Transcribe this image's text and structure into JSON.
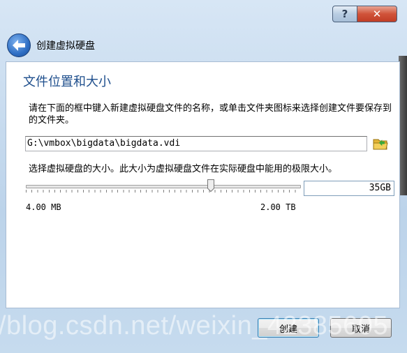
{
  "window": {
    "help_label": "?",
    "close_label": "✕"
  },
  "header": {
    "title": "创建虚拟硬盘",
    "back_icon": "back-arrow-icon"
  },
  "content": {
    "section_title": "文件位置和大小",
    "description": "请在下面的框中键入新建虚拟硬盘文件的名称，或单击文件夹图标来选择创建文件要保存到的文件夹。",
    "file_path": "G:\\vmbox\\bigdata\\bigdata.vdi",
    "folder_icon": "folder-icon",
    "size_label": "选择虚拟硬盘的大小。此大小为虚拟硬盘文件在实际硬盘中能用的极限大小。",
    "size_value": "35GB",
    "slider_position": 0.68,
    "min_label": "4.00 MB",
    "max_label": "2.00 TB"
  },
  "buttons": {
    "create_label": "创建",
    "cancel_label": "取消"
  },
  "watermark": "/blog.csdn.net/weixin_42385605",
  "colors": {
    "title_blue": "#1e4e8c",
    "close_red": "#c13d25"
  }
}
